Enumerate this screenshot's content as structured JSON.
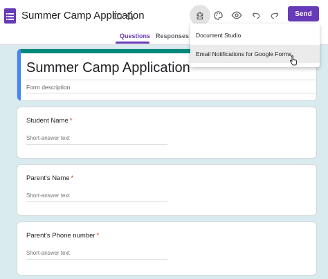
{
  "header": {
    "title": "Summer Camp Application",
    "send_label": "Send"
  },
  "tabs": [
    {
      "label": "Questions",
      "active": true
    },
    {
      "label": "Responses",
      "active": false
    }
  ],
  "addons_menu": {
    "items": [
      "Document Studio",
      "Email Notifications for Google Forms"
    ],
    "hovered_index": 1
  },
  "form": {
    "title": "Summer Camp Application",
    "description_placeholder": "Form description",
    "questions": [
      {
        "title": "Student Name",
        "required_mark": "*",
        "answer_placeholder": "Short-answer text"
      },
      {
        "title": "Parent's Name",
        "required_mark": "*",
        "answer_placeholder": "Short-answer text"
      },
      {
        "title": "Parent's Phone number",
        "required_mark": "*",
        "answer_placeholder": "Short-answer text"
      }
    ]
  },
  "colors": {
    "accent": "#673ab7",
    "page_background": "#d9ebee",
    "title_band": "#00897b",
    "required": "#d93025"
  },
  "icons": [
    "forms-logo-icon",
    "folder-icon",
    "star-icon",
    "addons-puzzle-icon",
    "palette-icon",
    "eye-preview-icon",
    "undo-icon",
    "redo-icon",
    "pointer-cursor-icon"
  ]
}
